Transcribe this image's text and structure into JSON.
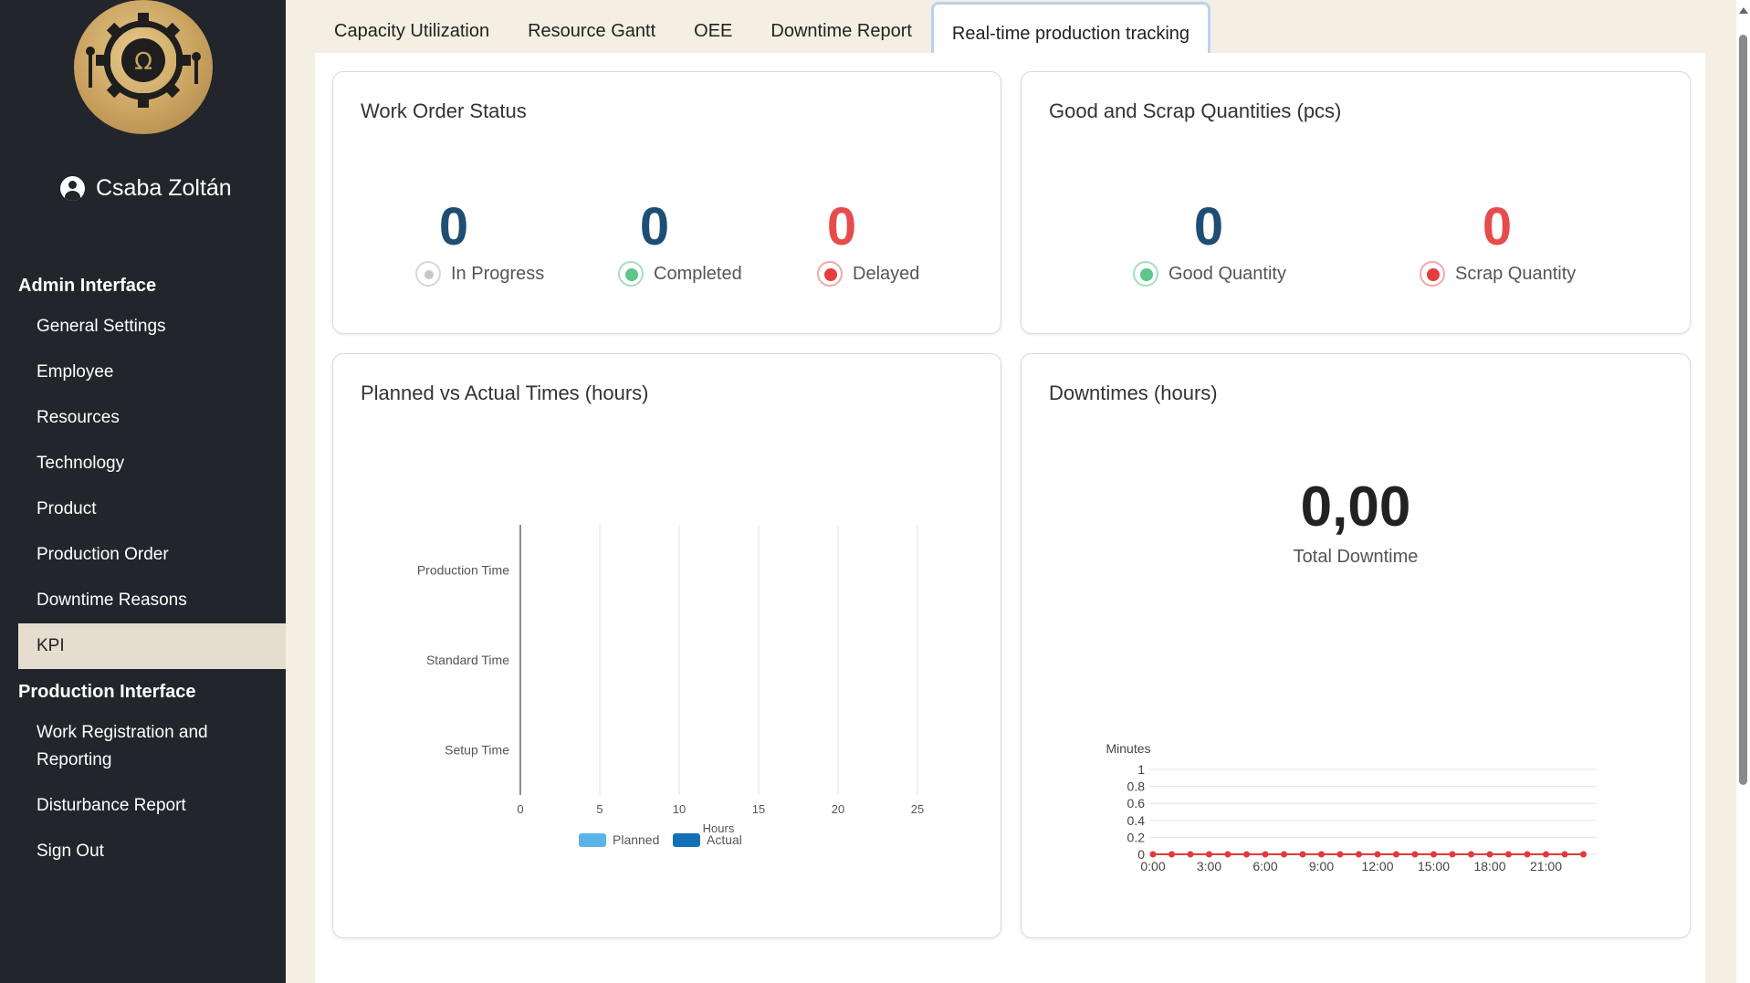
{
  "user": {
    "name": "Csaba Zoltán"
  },
  "sidebar": {
    "admin_heading": "Admin Interface",
    "admin_items": [
      {
        "label": "General Settings"
      },
      {
        "label": "Employee"
      },
      {
        "label": "Resources"
      },
      {
        "label": "Technology"
      },
      {
        "label": "Product"
      },
      {
        "label": "Production Order"
      },
      {
        "label": "Downtime Reasons"
      },
      {
        "label": "KPI",
        "active": true
      }
    ],
    "production_heading": "Production Interface",
    "production_items": [
      {
        "label": "Work Registration and Reporting"
      },
      {
        "label": "Disturbance Report"
      },
      {
        "label": "Sign Out"
      }
    ]
  },
  "tabs": [
    {
      "label": "Capacity Utilization"
    },
    {
      "label": "Resource Gantt"
    },
    {
      "label": "OEE"
    },
    {
      "label": "Downtime Report"
    },
    {
      "label": "Real-time production tracking",
      "active": true
    }
  ],
  "work_order": {
    "title": "Work Order Status",
    "in_progress": {
      "value": "0",
      "label": "In Progress"
    },
    "completed": {
      "value": "0",
      "label": "Completed"
    },
    "delayed": {
      "value": "0",
      "label": "Delayed"
    }
  },
  "quantities": {
    "title": "Good and Scrap Quantities (pcs)",
    "good": {
      "value": "0",
      "label": "Good Quantity"
    },
    "scrap": {
      "value": "0",
      "label": "Scrap Quantity"
    }
  },
  "planned_actual": {
    "title": "Planned vs Actual Times (hours)"
  },
  "downtimes": {
    "title": "Downtimes (hours)",
    "total_value": "0,00",
    "total_label": "Total Downtime"
  },
  "colors": {
    "status_blue": "#1f4e74",
    "status_red": "#e74c4c",
    "planned": "#5ab4e8",
    "actual": "#1170b8",
    "downtime_line": "#e03a3a"
  },
  "chart_data": [
    {
      "type": "bar",
      "orientation": "horizontal",
      "categories": [
        "Production Time",
        "Standard Time",
        "Setup Time"
      ],
      "series": [
        {
          "name": "Planned",
          "values": [
            0,
            0,
            0
          ],
          "color": "#5ab4e8"
        },
        {
          "name": "Actual",
          "values": [
            0,
            0,
            0
          ],
          "color": "#1170b8"
        }
      ],
      "xlabel": "Hours",
      "xticks": [
        0,
        5,
        10,
        15,
        20,
        25
      ],
      "xlim": [
        0,
        25
      ],
      "legend": "bottom",
      "grid": true
    },
    {
      "type": "line",
      "x": [
        "0:00",
        "1:00",
        "2:00",
        "3:00",
        "4:00",
        "5:00",
        "6:00",
        "7:00",
        "8:00",
        "9:00",
        "10:00",
        "11:00",
        "12:00",
        "13:00",
        "14:00",
        "15:00",
        "16:00",
        "17:00",
        "18:00",
        "19:00",
        "20:00",
        "21:00",
        "22:00",
        "23:00"
      ],
      "xticks": [
        "0:00",
        "3:00",
        "6:00",
        "9:00",
        "12:00",
        "15:00",
        "18:00",
        "21:00"
      ],
      "series": [
        {
          "values": [
            0,
            0,
            0,
            0,
            0,
            0,
            0,
            0,
            0,
            0,
            0,
            0,
            0,
            0,
            0,
            0,
            0,
            0,
            0,
            0,
            0,
            0,
            0,
            0
          ],
          "color": "#e03a3a"
        }
      ],
      "ylabel": "Minutes",
      "yticks": [
        "0",
        "0.2",
        "0.4",
        "0.6",
        "0.8",
        "1"
      ],
      "ylim": [
        0,
        1
      ],
      "grid": true
    }
  ]
}
